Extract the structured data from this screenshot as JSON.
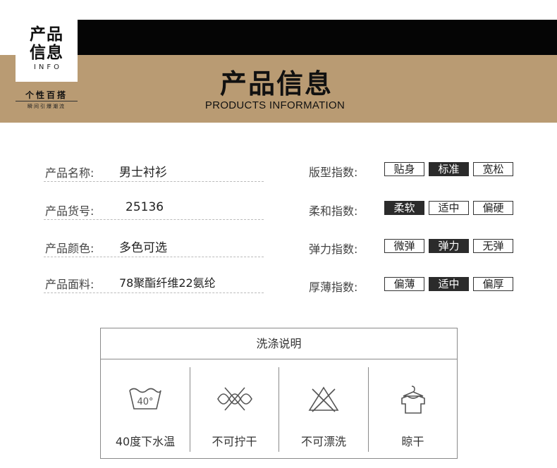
{
  "header": {
    "logo_line1": "产品",
    "logo_line2": "信息",
    "logo_info": "INFO",
    "slogan_main": "个性百搭",
    "slogan_sub": "瞬间引爆潮流",
    "title": "产品信息",
    "subtitle": "PRODUCTS INFORMATION"
  },
  "info": [
    {
      "label": "产品名称:",
      "value": "男士衬衫"
    },
    {
      "label": "产品货号:",
      "value": "25136"
    },
    {
      "label": "产品颜色:",
      "value": "多色可选"
    },
    {
      "label": "产品面料:",
      "value": "78聚酯纤维22氨纶"
    }
  ],
  "indices": [
    {
      "label": "版型指数:",
      "options": [
        "贴身",
        "标准",
        "宽松"
      ],
      "selected": 1
    },
    {
      "label": "柔和指数:",
      "options": [
        "柔软",
        "适中",
        "偏硬"
      ],
      "selected": 0
    },
    {
      "label": "弹力指数:",
      "options": [
        "微弹",
        "弹力",
        "无弹"
      ],
      "selected": 1
    },
    {
      "label": "厚薄指数:",
      "options": [
        "偏薄",
        "适中",
        "偏厚"
      ],
      "selected": 1
    }
  ],
  "washing": {
    "title": "洗涤说明",
    "items": [
      {
        "icon": "wash-40-icon",
        "icon_text": "40°",
        "label": "40度下水温"
      },
      {
        "icon": "no-wring-icon",
        "label": "不可拧干"
      },
      {
        "icon": "no-bleach-icon",
        "label": "不可漂洗"
      },
      {
        "icon": "hang-dry-icon",
        "label": "晾干"
      }
    ]
  },
  "colors": {
    "active_chip": "#2b2b2b",
    "banner_tan": "#b99b73",
    "banner_black": "#050505"
  }
}
